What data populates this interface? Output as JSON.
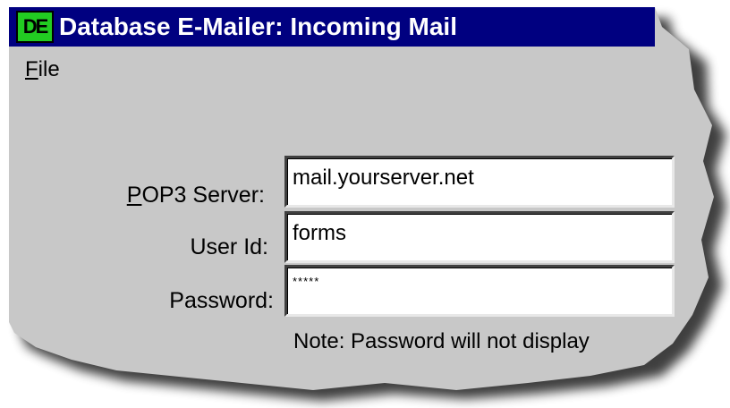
{
  "window": {
    "icon_text": "DE",
    "title": "Database E-Mailer: Incoming Mail"
  },
  "menu": {
    "file_first": "F",
    "file_rest": "ile"
  },
  "form": {
    "pop3": {
      "label_first": "P",
      "label_rest": "OP3 Server:",
      "value": "mail.yourserver.net"
    },
    "userid": {
      "label": "User Id:",
      "value": "forms"
    },
    "password": {
      "label": "Password:",
      "value": "*****"
    },
    "note": "Note: Password will not display"
  },
  "colors": {
    "titlebar": "#000080",
    "window_bg": "#c8c8c8",
    "icon_bg": "#22cc22"
  }
}
